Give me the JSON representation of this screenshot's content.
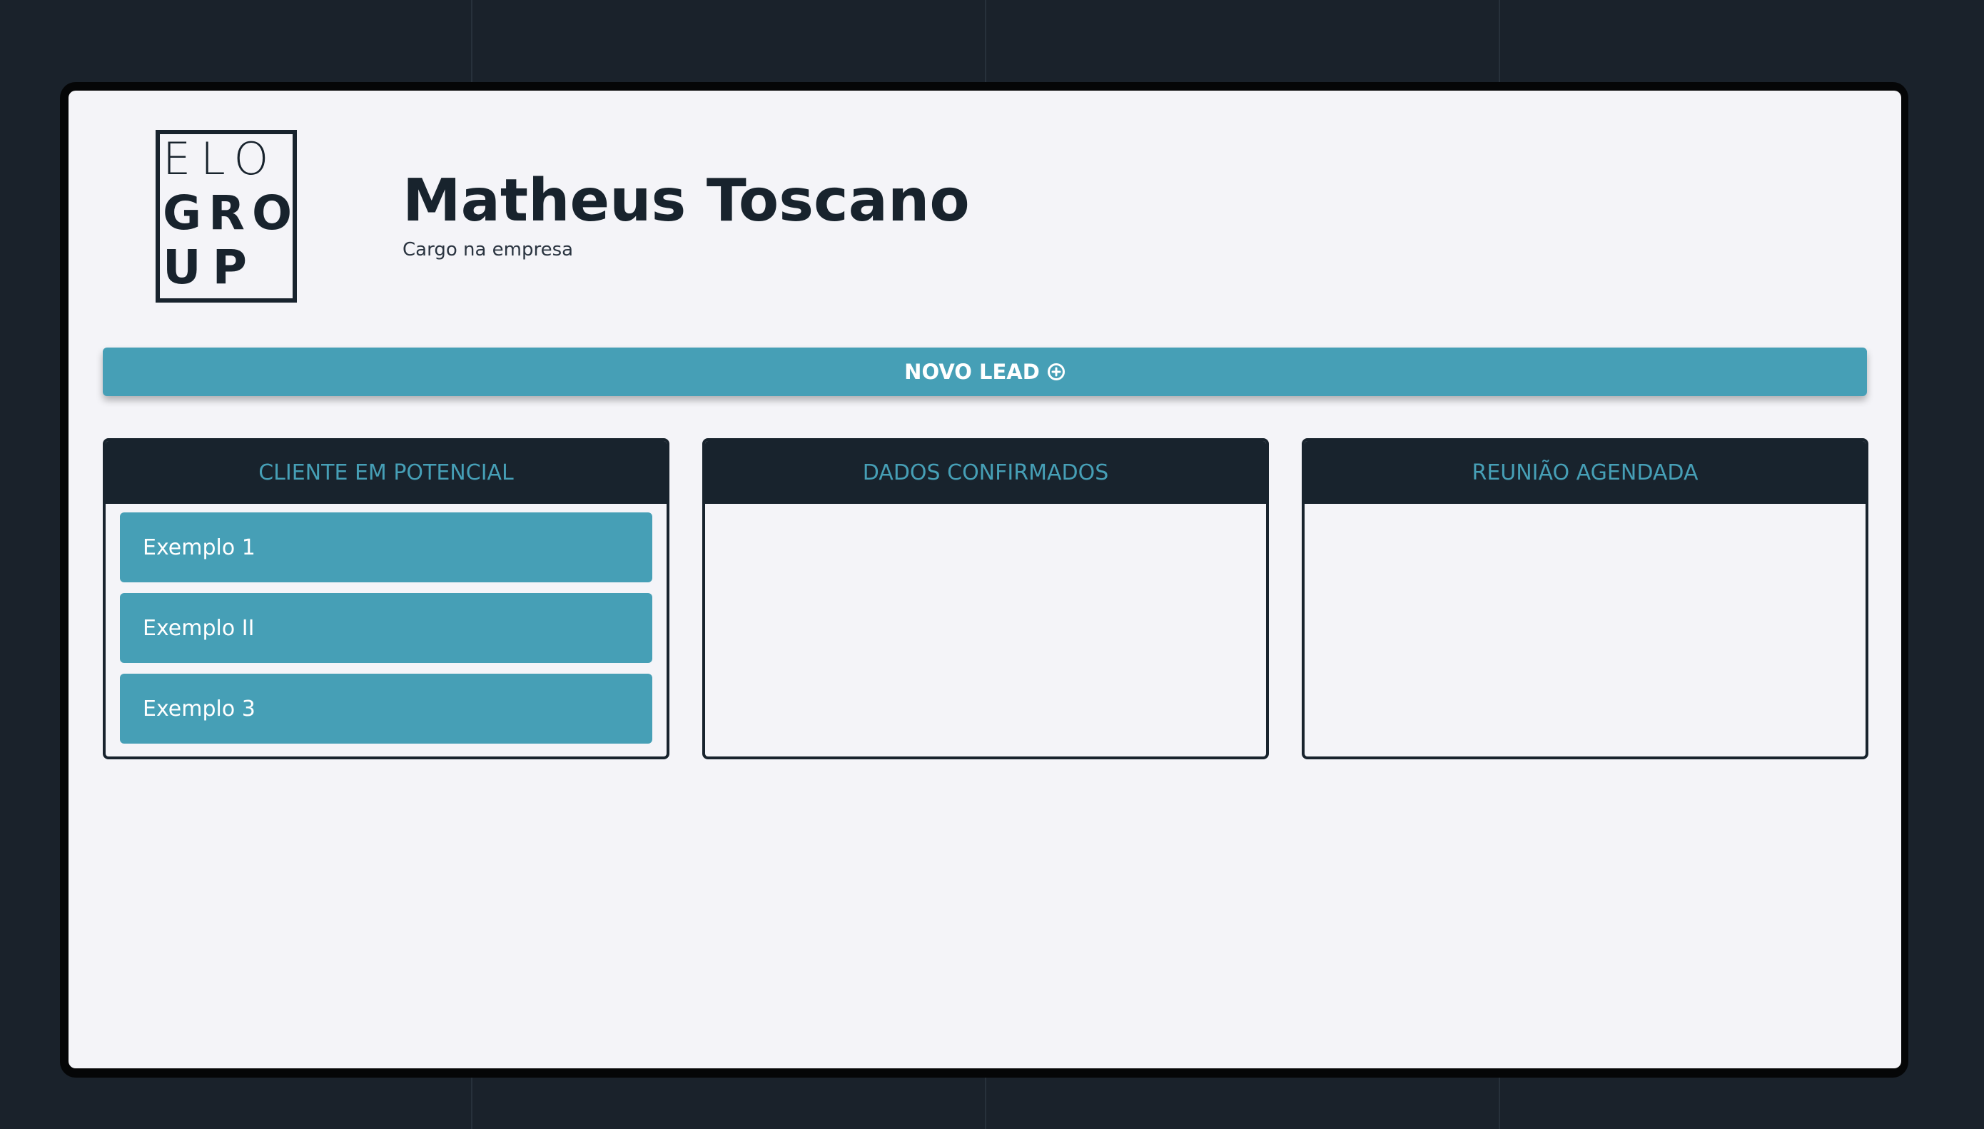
{
  "logo": {
    "row1": "ELO",
    "row2": "GRO",
    "row3": "UP"
  },
  "user": {
    "name": "Matheus Toscano",
    "role": "Cargo na empresa"
  },
  "toolbar": {
    "new_lead_label": "NOVO LEAD"
  },
  "columns": [
    {
      "title": "CLIENTE EM POTENCIAL",
      "cards": [
        {
          "label": "Exemplo 1"
        },
        {
          "label": "Exemplo II"
        },
        {
          "label": "Exemplo 3"
        }
      ]
    },
    {
      "title": "DADOS CONFIRMADOS",
      "cards": []
    },
    {
      "title": "REUNIÃO AGENDADA",
      "cards": []
    }
  ],
  "colors": {
    "accent": "#469fb6",
    "dark": "#18232d",
    "surface": "#f4f4f8",
    "backdrop": "#1a222b"
  },
  "icons": {
    "new_lead": "plus-circle-icon"
  }
}
